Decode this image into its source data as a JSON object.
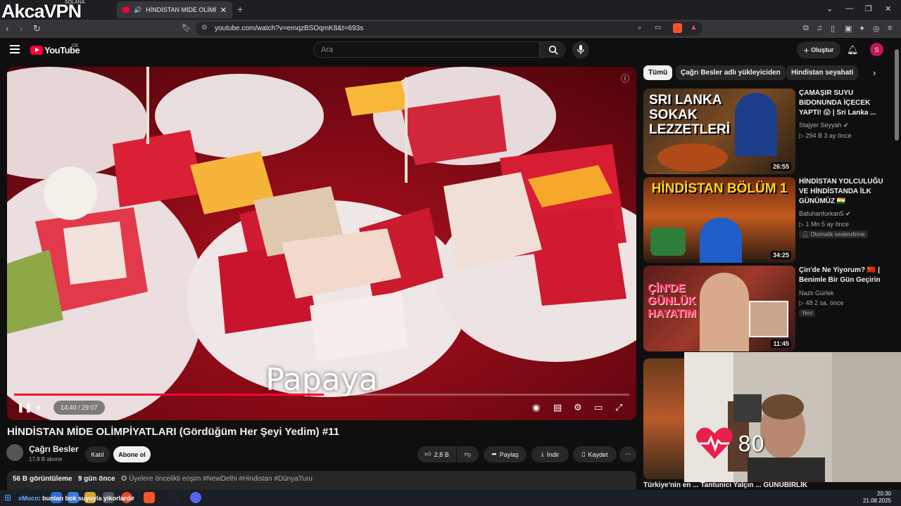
{
  "browser": {
    "overlay_brand": "AkcaVPN",
    "overlay_brand_sub": "SOLANA",
    "tab_title": "HİNDİSTAN MİDE OLİMPİYATLARI",
    "new_tab": "+",
    "url": "youtube.com/watch?v=emqzBSOqmK8&t=693s"
  },
  "youtube": {
    "logo_text": "YouTube",
    "country": "DE",
    "search_placeholder": "Ara",
    "create_label": "Oluştur",
    "avatar_letter": "S",
    "accent": "#ff0033"
  },
  "player": {
    "subtitle": "Papaya",
    "time": "14:40 / 29:07",
    "progress_fraction": 0.504
  },
  "video": {
    "title": "HİNDİSTAN MİDE OLİMPİYATLARI (Gördüğüm Her Şeyi Yedim) #11",
    "channel": "Çağrı Besler",
    "subscribers": "17,9 B abone",
    "join_label": "Katıl",
    "subscribe_label": "Abone ol",
    "likes": "2,8 B",
    "share_label": "Paylaş",
    "download_label": "İndir",
    "save_label": "Kaydet",
    "views": "56 B görüntüleme",
    "age": "9 gün önce",
    "members_label": "Üyelere öncelikli erişim",
    "hashtags": "#NewDelhi #Hindistan #DünyaTuru"
  },
  "sidebar": {
    "chips": [
      "Tümü",
      "Çağrı Besler adlı yükleyiciden",
      "Hindistan seyahati"
    ],
    "cards": [
      {
        "title": "ÇAMAŞIR SUYU BIDONUNDA İÇECEK YAPTI! 😱 | Sri Lanka ...",
        "channel": "Stajyer Seyyah",
        "meta": "294 B  3 ay önce",
        "duration": "26:55",
        "thumb_text": "SRI LANKA SOKAK LEZZETLERİ"
      },
      {
        "title": "HİNDİSTAN YOLCULUĞU VE HİNDİSTANDA İLK GÜNÜMÜZ 🇮🇳",
        "channel": "Batuhanfurkan5",
        "meta": "1 Mn  5 ay önce",
        "duration": "34:25",
        "badge": "Otomatik seslendirme",
        "thumb_text": "HİNDİSTAN BÖLÜM 1"
      },
      {
        "title": "Çin'de Ne Yiyorum? 🇨🇳 | Benimle Bir Gün Geçirin",
        "channel": "Nazlı Gürlek",
        "meta": "48  2 sa. önce",
        "duration": "11:45",
        "badge": "Yeni",
        "thumb_text": "ÇİN'DE GÜNLÜK HAYATIM"
      }
    ],
    "partial_row": "Türkiye'nin en ...   Tantunici Yalçın ...   GÜNÜBİRLİK"
  },
  "webcam": {
    "heart_rate": "80"
  },
  "taskbar": {
    "user": "xMuco",
    "message": ": bunları bok suyuyla yikorlardır",
    "time": "20:30",
    "date": "21.08.2025"
  }
}
